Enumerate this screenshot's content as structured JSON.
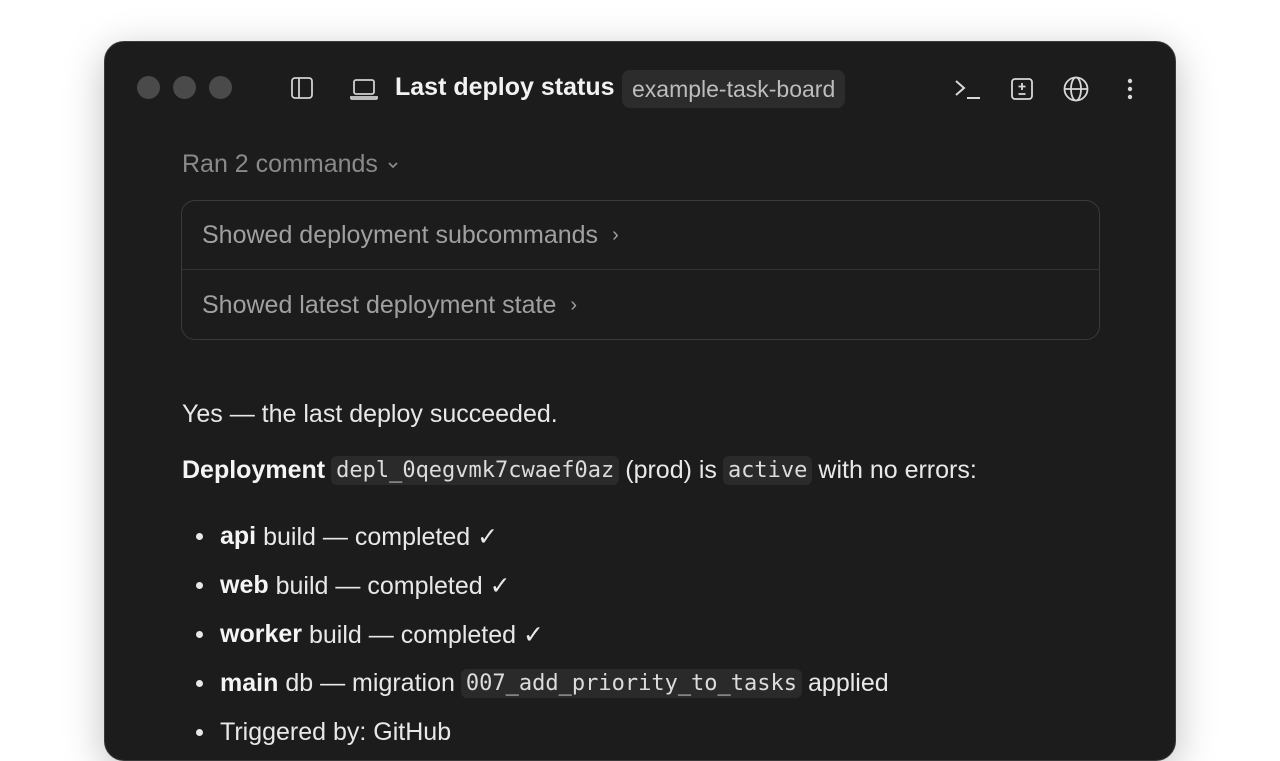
{
  "window": {
    "title": "Last deploy status",
    "repo_badge": "example-task-board"
  },
  "icons": {
    "sidebar_toggle": "sidebar-toggle-icon",
    "laptop": "laptop-icon",
    "terminal": "terminal-icon",
    "diff": "diff-icon",
    "globe": "globe-icon",
    "more": "more-vertical-icon"
  },
  "commands": {
    "header": "Ran 2 commands",
    "items": [
      {
        "label": "Showed deployment subcommands"
      },
      {
        "label": "Showed latest deployment state"
      }
    ]
  },
  "message": {
    "answer": "Yes — the last deploy succeeded.",
    "deploy_prefix": "Deployment",
    "deploy_id": "depl_0qegvmk7cwaef0az",
    "deploy_env": "(prod) is",
    "deploy_state": "active",
    "deploy_suffix": "with no errors:",
    "bullets": [
      {
        "bold": "api",
        "text": "build — completed ✓"
      },
      {
        "bold": "web",
        "text": "build — completed ✓"
      },
      {
        "bold": "worker",
        "text": "build — completed ✓"
      },
      {
        "bold": "main",
        "text": "db — migration",
        "code": "007_add_priority_to_tasks",
        "after": "applied"
      },
      {
        "text": "Triggered by: GitHub"
      }
    ]
  },
  "colors": {
    "window_bg": "#1c1c1c",
    "text_primary": "#e8e8e8",
    "text_muted": "#8a8a8a"
  }
}
